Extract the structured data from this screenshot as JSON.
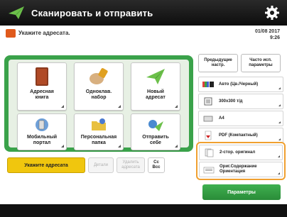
{
  "titlebar": {
    "title": "Сканировать и отправить"
  },
  "infobar": {
    "message": "Укажите адресата.",
    "date": "01/08 2017",
    "time": "9:26"
  },
  "main_tiles": [
    {
      "label": "Адресная\nкнига",
      "icon": "address-book-icon"
    },
    {
      "label": "Одноклав.\nнабор",
      "icon": "one-touch-icon"
    },
    {
      "label": "Новый\nадресат",
      "icon": "new-destination-icon"
    },
    {
      "label": "Мобильный\nпортал",
      "icon": "mobile-portal-icon"
    },
    {
      "label": "Персональная\nпапка",
      "icon": "personal-folder-icon"
    },
    {
      "label": "Отправить\nсебе",
      "icon": "send-to-myself-icon"
    }
  ],
  "bottom_buttons": {
    "specify": "Укажите адресата",
    "details": "Детали",
    "delete": "Удалить\nадресата",
    "cc_bcc": "Cc\nBcc"
  },
  "right_panel": {
    "prev_settings": "Предыдущие\nнастр.",
    "frequent": "Часто исп.\nпараметры",
    "color_mode": "Авто (Цв./Черный)",
    "resolution": "300x300 т/д",
    "size": "A4",
    "file_format": "PDF (Компактный)",
    "two_sided": "2-стор. оригинал",
    "orientation": "Ориг.Содержание\nОриентация",
    "options": "Параметры"
  },
  "colors": {
    "accent_green": "#3aa24a",
    "yellow": "#f0c60e",
    "highlight": "#f0a030"
  }
}
